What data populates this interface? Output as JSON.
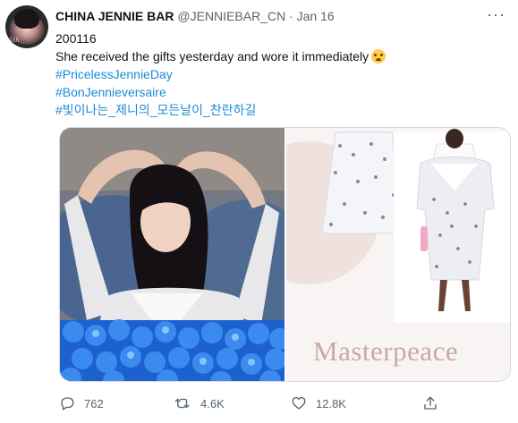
{
  "tweet": {
    "author_name": "CHINA JENNIE BAR",
    "handle": "@JENNIEBAR_CN",
    "separator": "·",
    "date": "Jan 16",
    "more_label": "···",
    "line1": "200116",
    "line2": "She received the gifts yesterday and wore it immediately",
    "hashtags": [
      "#PricelessJennieDay",
      "#BonJennieversaire",
      "#빛이나는_제니의_모든날이_찬란하길"
    ]
  },
  "avatar": {
    "text": "5th"
  },
  "media": {
    "caption": "Masterpeace"
  },
  "actions": {
    "reply_count": "762",
    "retweet_count": "4.6K",
    "like_count": "12.8K"
  },
  "icons": [
    "more-icon",
    "reply-icon",
    "retweet-icon",
    "like-icon",
    "share-icon",
    "crying-emoji-icon"
  ],
  "colors": {
    "hashtag": "#1b8bd8",
    "muted": "#536471",
    "text": "#0f1419"
  }
}
